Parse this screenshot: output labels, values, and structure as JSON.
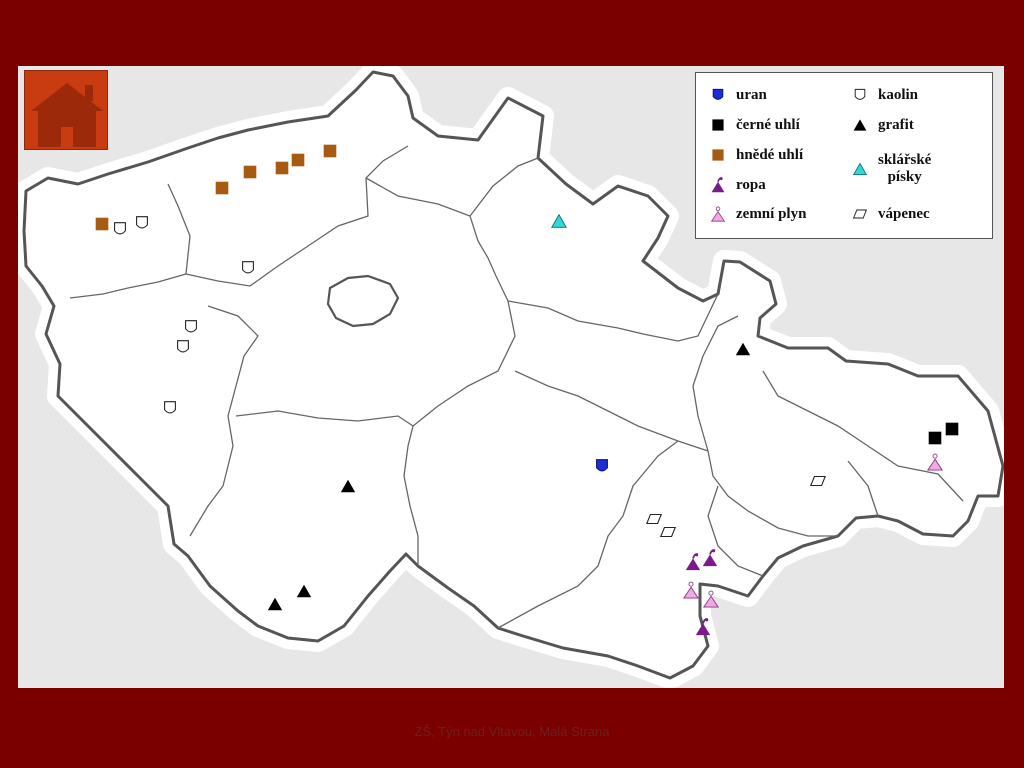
{
  "legend": {
    "items": [
      {
        "key": "uran",
        "label": "uran",
        "symbol": "blue-shield",
        "color": "#1c2fd6"
      },
      {
        "key": "kaolin",
        "label": "kaolin",
        "symbol": "white-shield",
        "color": "#ffffff"
      },
      {
        "key": "cerne_uhli",
        "label": "černé uhlí",
        "symbol": "black-square",
        "color": "#000000"
      },
      {
        "key": "grafit",
        "label": "grafit",
        "symbol": "black-triangle",
        "color": "#000000"
      },
      {
        "key": "hnede_uhli",
        "label": "hnědé uhlí",
        "symbol": "brown-square",
        "color": "#a65a12"
      },
      {
        "key": "sklarske_pisky",
        "label": "sklářské\npísky",
        "symbol": "cyan-triangle",
        "color": "#33d6d6"
      },
      {
        "key": "ropa",
        "label": "ropa",
        "symbol": "purple-drop-triangle",
        "color": "#7a1a8c"
      },
      {
        "key": "zemni_plyn",
        "label": "zemní plyn",
        "symbol": "pink-drop-triangle",
        "color": "#f0a8e6"
      },
      {
        "key": "vapenec",
        "label": "vápenec",
        "symbol": "parallelogram",
        "color": "#ffffff"
      }
    ]
  },
  "footer": {
    "text": "ZŠ, Týn nad Vltavou, Malá Strana"
  },
  "colors": {
    "background": "#7a0000",
    "map_background": "#e7e7e7",
    "home_button": "#c93b10"
  }
}
